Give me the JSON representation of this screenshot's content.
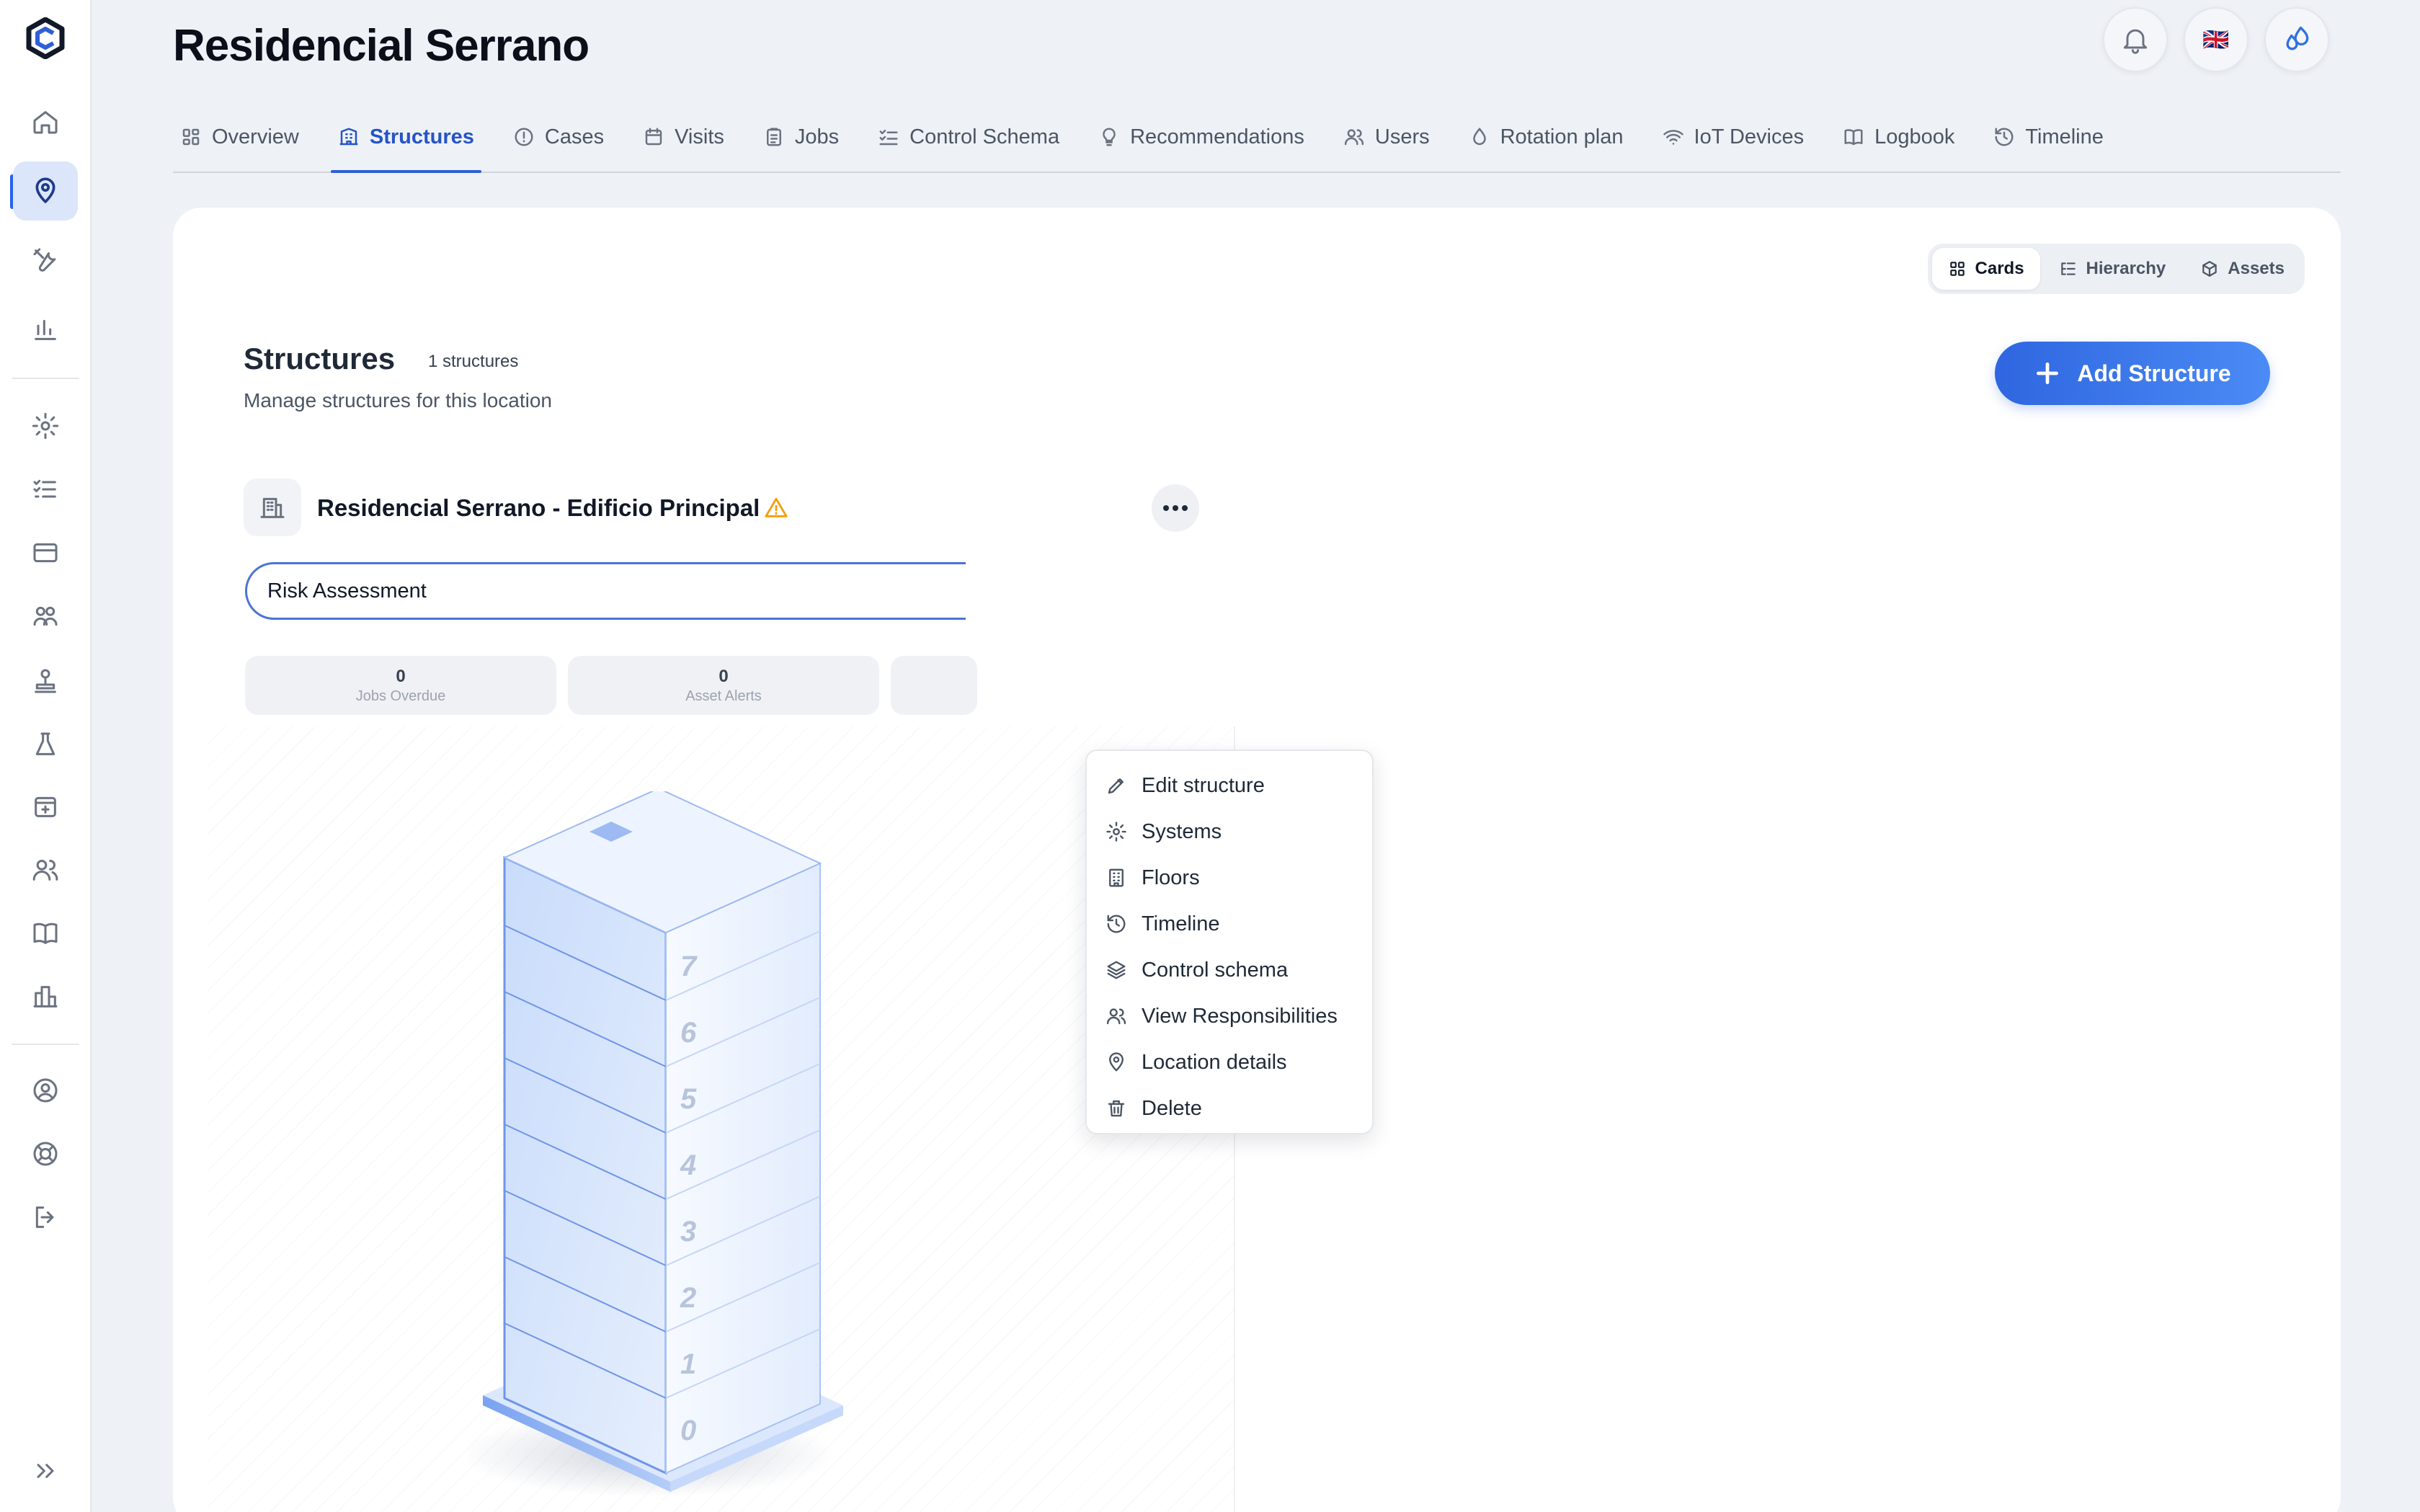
{
  "sidebar": {
    "expand_label": "",
    "items": [
      {
        "icon": "home-icon"
      },
      {
        "icon": "map-pin-icon",
        "active": true
      },
      {
        "icon": "tools-icon"
      },
      {
        "icon": "bar-chart-icon"
      },
      {
        "icon": "gear-icon"
      },
      {
        "icon": "checklist-icon"
      },
      {
        "icon": "credit-card-icon"
      },
      {
        "icon": "team-icon"
      },
      {
        "icon": "stamp-icon"
      },
      {
        "icon": "flask-icon"
      },
      {
        "icon": "calendar-plus-icon"
      },
      {
        "icon": "users-icon"
      },
      {
        "icon": "book-icon"
      },
      {
        "icon": "buildings-icon"
      },
      {
        "icon": "user-circle-icon"
      },
      {
        "icon": "lifebuoy-icon"
      },
      {
        "icon": "logout-icon"
      },
      {
        "icon": "chevrons-right-icon"
      }
    ]
  },
  "header": {
    "title": "Residencial Serrano",
    "flag": "🇬🇧"
  },
  "tabs": [
    {
      "label": "Overview",
      "icon": "grid-icon"
    },
    {
      "label": "Structures",
      "icon": "building-icon",
      "active": true
    },
    {
      "label": "Cases",
      "icon": "alert-circle-icon"
    },
    {
      "label": "Visits",
      "icon": "calendar-icon"
    },
    {
      "label": "Jobs",
      "icon": "clipboard-icon"
    },
    {
      "label": "Control Schema",
      "icon": "list-checks-icon"
    },
    {
      "label": "Recommendations",
      "icon": "lightbulb-icon"
    },
    {
      "label": "Users",
      "icon": "users-icon"
    },
    {
      "label": "Rotation plan",
      "icon": "droplet-icon"
    },
    {
      "label": "IoT Devices",
      "icon": "wifi-icon"
    },
    {
      "label": "Logbook",
      "icon": "book-open-icon"
    },
    {
      "label": "Timeline",
      "icon": "history-icon"
    }
  ],
  "view_toggle": {
    "cards": "Cards",
    "hierarchy": "Hierarchy",
    "assets": "Assets"
  },
  "section": {
    "title": "Structures",
    "count": "1 structures",
    "subtitle": "Manage structures for this location",
    "add_button": "Add Structure"
  },
  "card": {
    "title": "Residencial Serrano - Edificio Principal",
    "select_value": "Risk Assessment",
    "stats": [
      {
        "value": "0",
        "label": "Jobs Overdue"
      },
      {
        "value": "0",
        "label": "Asset Alerts"
      }
    ],
    "floors": [
      "7",
      "6",
      "5",
      "4",
      "3",
      "2",
      "1",
      "0"
    ]
  },
  "menu": {
    "items": [
      {
        "label": "Edit structure",
        "icon": "pencil-icon"
      },
      {
        "label": "Systems",
        "icon": "gear-icon"
      },
      {
        "label": "Floors",
        "icon": "building-floors-icon"
      },
      {
        "label": "Timeline",
        "icon": "history-icon"
      },
      {
        "label": "Control schema",
        "icon": "layers-icon"
      },
      {
        "label": "View Responsibilities",
        "icon": "users-icon"
      },
      {
        "label": "Location details",
        "icon": "map-pin-icon"
      },
      {
        "label": "Delete",
        "icon": "trash-icon"
      }
    ]
  },
  "colors": {
    "accent": "#2f5fd6",
    "warning": "#f59e0b",
    "sidebar_active_bg": "#dbe6fb"
  }
}
